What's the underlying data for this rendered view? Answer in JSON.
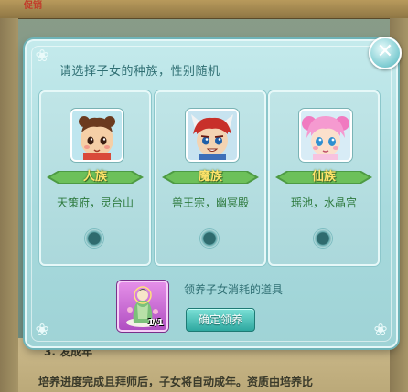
{
  "background": {
    "top_tab_text": "促销",
    "bottom_line1": "3. 发成年",
    "bottom_line2": "培养进度完成且拜师后，子女将自动成年。资质由培养比"
  },
  "dialog": {
    "title": "请选择子女的种族，性别随机",
    "races": [
      {
        "name": "人族",
        "desc": "天策府，灵台山",
        "portrait": "human-child-portrait"
      },
      {
        "name": "魔族",
        "desc": "兽王宗，幽冥殿",
        "portrait": "demon-child-portrait"
      },
      {
        "name": "仙族",
        "desc": "瑶池，水晶宫",
        "portrait": "immortal-child-portrait"
      }
    ],
    "item": {
      "count": "1/1",
      "label": "领养子女消耗的道具",
      "icon": "guanyin-statue-icon"
    },
    "confirm_label": "确定领养",
    "close_icon": "close-icon"
  }
}
